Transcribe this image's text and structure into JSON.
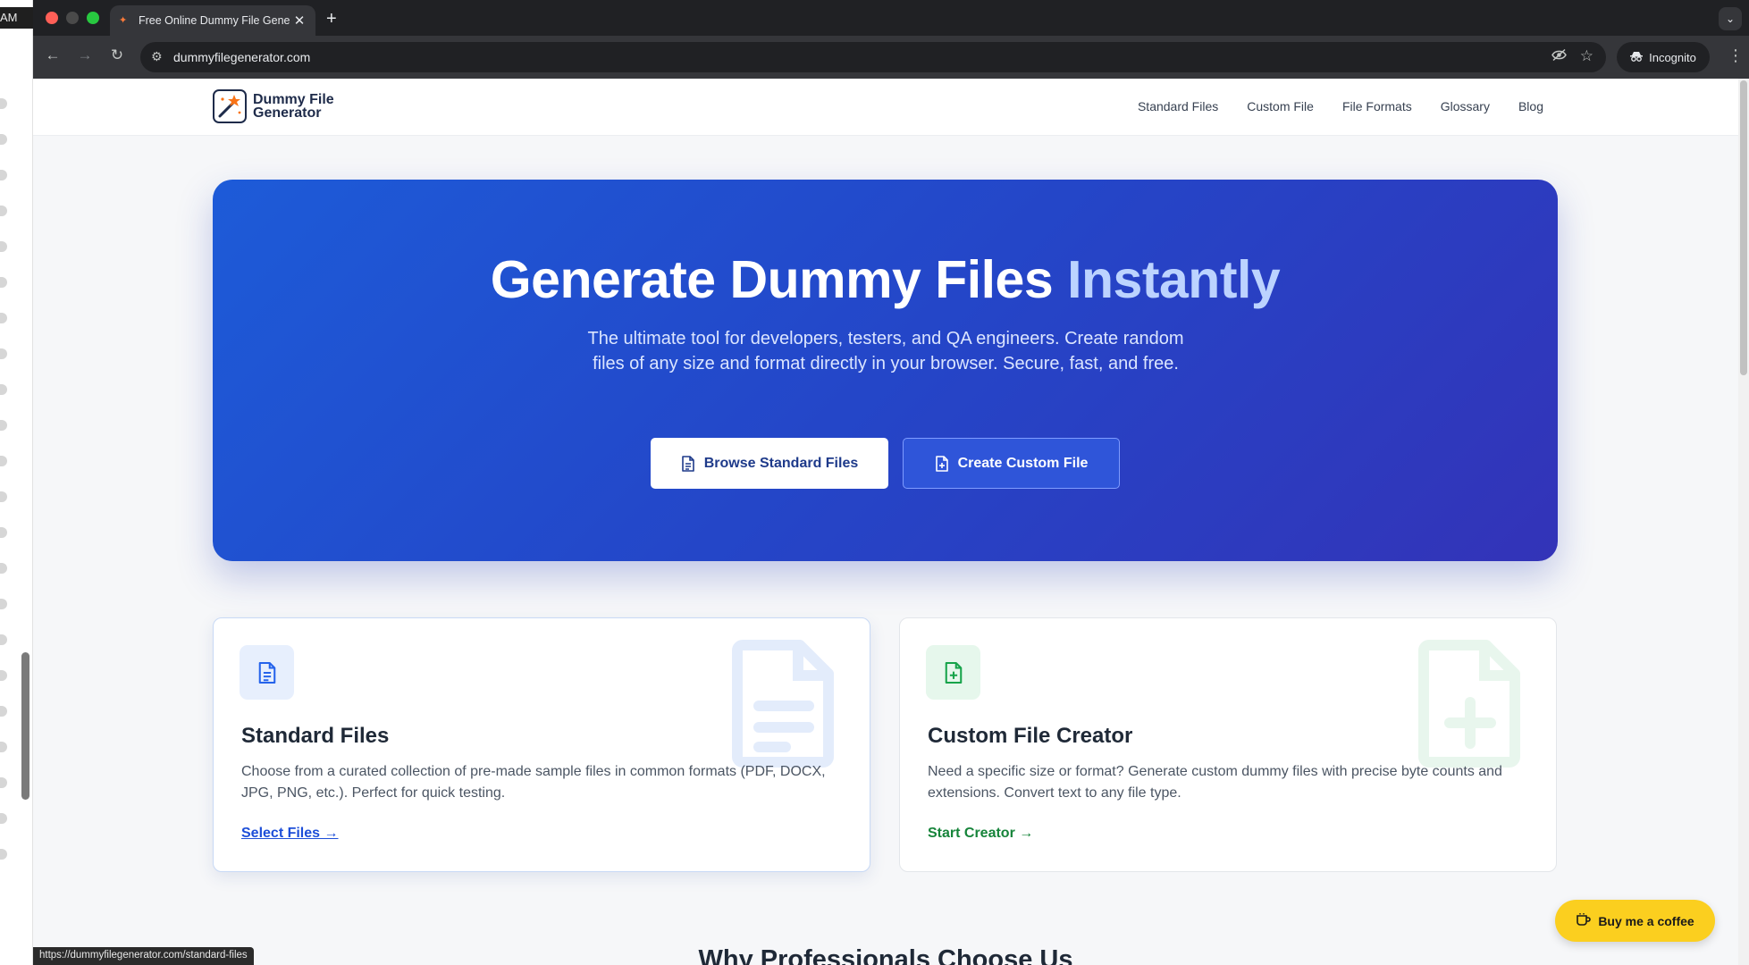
{
  "left_strip": {
    "time_fragment": "AM"
  },
  "browser": {
    "tab_title": "Free Online Dummy File Gene",
    "tab_close": "✕",
    "new_tab": "+",
    "url": "dummyfilegenerator.com",
    "profile_label": "Incognito",
    "status_url": "https://dummyfilegenerator.com/standard-files"
  },
  "header": {
    "logo_line1": "Dummy File",
    "logo_line2": "Generator",
    "nav": [
      "Standard Files",
      "Custom File",
      "File Formats",
      "Glossary",
      "Blog"
    ]
  },
  "hero": {
    "title_main": "Generate Dummy Files ",
    "title_accent": "Instantly",
    "subtitle": "The ultimate tool for developers, testers, and QA engineers. Create random files of any size and format directly in your browser. Secure, fast, and free.",
    "primary_button": "Browse Standard Files",
    "secondary_button": "Create Custom File"
  },
  "cards": [
    {
      "title": "Standard Files",
      "description": "Choose from a curated collection of pre-made sample files in common formats (PDF, DOCX, JPG, PNG, etc.). Perfect for quick testing.",
      "link": "Select Files →",
      "icon": "file-text-icon"
    },
    {
      "title": "Custom File Creator",
      "description": "Need a specific size or format? Generate custom dummy files with precise byte counts and extensions. Convert text to any file type.",
      "link": "Start Creator →",
      "icon": "file-plus-icon"
    }
  ],
  "coffee_button": "Buy me a coffee",
  "section_heading": "Why Professionals Choose Us",
  "colors": {
    "hero_start": "#1d5bd8",
    "hero_end": "#3333b8",
    "accent_text": "#bcd3ff",
    "link_blue": "#1d4ed8",
    "link_green": "#16843a",
    "coffee_yellow": "#fbcf1f"
  }
}
